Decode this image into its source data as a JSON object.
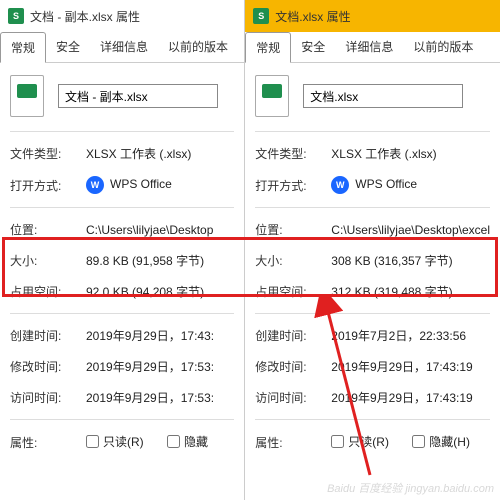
{
  "left": {
    "title": "文档 - 副本.xlsx 属性",
    "filename": "文档 - 副本.xlsx",
    "tabs": [
      "常规",
      "安全",
      "详细信息",
      "以前的版本"
    ],
    "fileType": "XLSX 工作表 (.xlsx)",
    "openWith": "WPS Office",
    "location": "C:\\Users\\lilyjae\\Desktop",
    "size": "89.8 KB (91,958 字节)",
    "sizeOnDisk": "92.0 KB (94,208 字节)",
    "created": "2019年9月29日，17:43:",
    "modified": "2019年9月29日，17:53:",
    "accessed": "2019年9月29日，17:53:",
    "attrReadonly": "只读(R)",
    "attrHidden": "隐藏"
  },
  "right": {
    "title": "文档.xlsx 属性",
    "filename": "文档.xlsx",
    "tabs": [
      "常规",
      "安全",
      "详细信息",
      "以前的版本"
    ],
    "fileType": "XLSX 工作表 (.xlsx)",
    "openWith": "WPS Office",
    "location": "C:\\Users\\lilyjae\\Desktop\\excel",
    "size": "308 KB (316,357 字节)",
    "sizeOnDisk": "312 KB (319,488 字节)",
    "created": "2019年7月2日，22:33:56",
    "modified": "2019年9月29日，17:43:19",
    "accessed": "2019年9月29日，17:43:19",
    "attrReadonly": "只读(R)",
    "attrHidden": "隐藏(H)"
  },
  "labels": {
    "fileType": "文件类型:",
    "openWith": "打开方式:",
    "location": "位置:",
    "size": "大小:",
    "sizeOnDisk": "占用空间:",
    "created": "创建时间:",
    "modified": "修改时间:",
    "accessed": "访问时间:",
    "attributes": "属性:"
  },
  "watermark": "Baidu 百度经验 jingyan.baidu.com"
}
